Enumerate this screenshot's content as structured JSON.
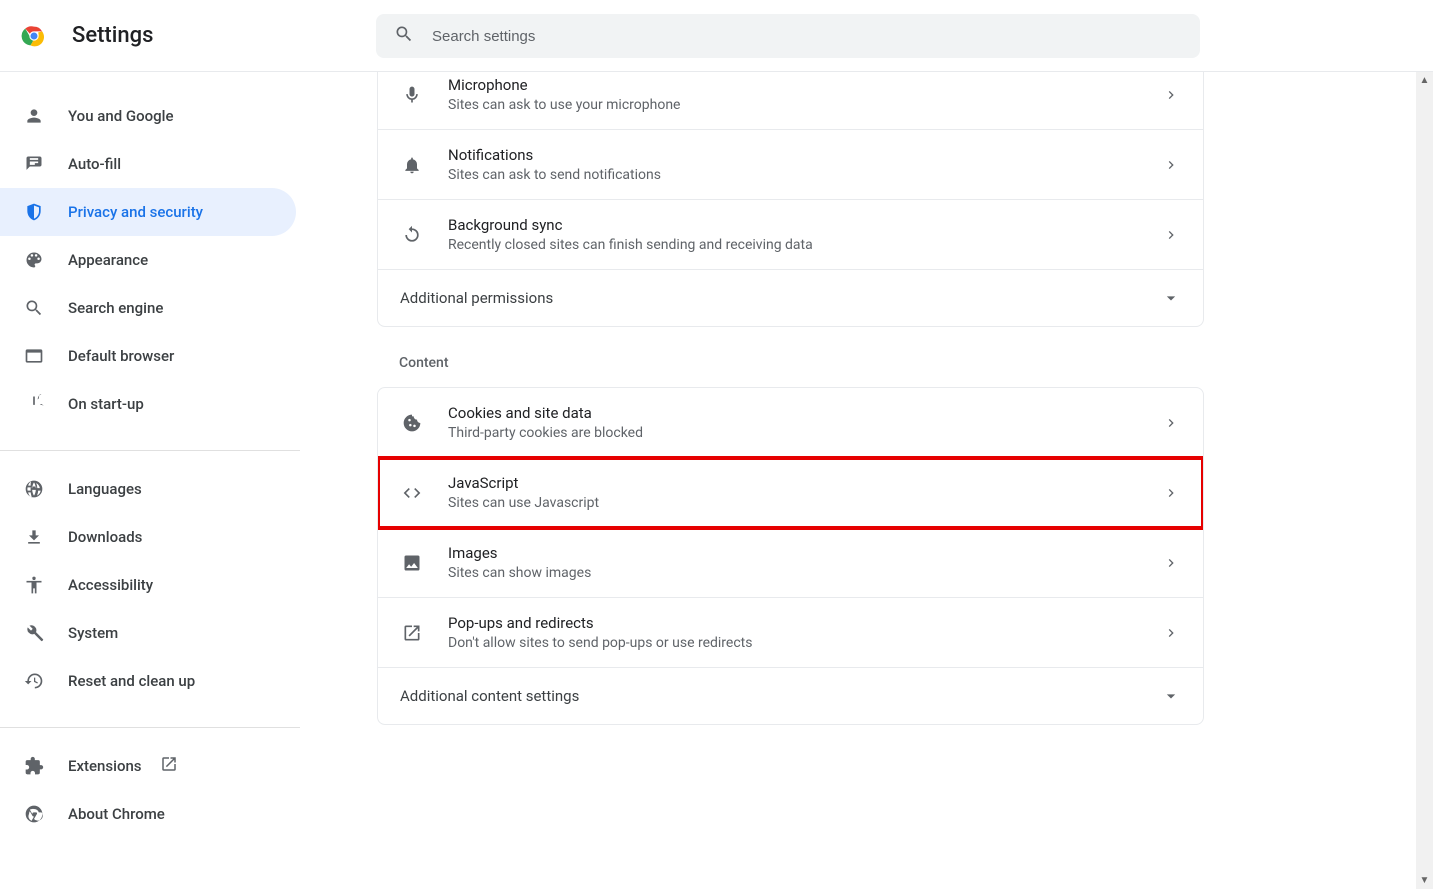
{
  "header": {
    "title": "Settings",
    "search_placeholder": "Search settings"
  },
  "sidebar": {
    "group1": [
      {
        "label": "You and Google",
        "icon": "person"
      },
      {
        "label": "Auto-fill",
        "icon": "autofill"
      },
      {
        "label": "Privacy and security",
        "icon": "shield",
        "active": true
      },
      {
        "label": "Appearance",
        "icon": "palette"
      },
      {
        "label": "Search engine",
        "icon": "search"
      },
      {
        "label": "Default browser",
        "icon": "browser"
      },
      {
        "label": "On start-up",
        "icon": "power"
      }
    ],
    "group2": [
      {
        "label": "Languages",
        "icon": "globe"
      },
      {
        "label": "Downloads",
        "icon": "download"
      },
      {
        "label": "Accessibility",
        "icon": "accessibility"
      },
      {
        "label": "System",
        "icon": "wrench"
      },
      {
        "label": "Reset and clean up",
        "icon": "restore"
      }
    ],
    "group3": [
      {
        "label": "Extensions",
        "icon": "extension",
        "external": true
      },
      {
        "label": "About Chrome",
        "icon": "chrome"
      }
    ]
  },
  "permissions": {
    "rows": [
      {
        "title": "Microphone",
        "sub": "Sites can ask to use your microphone",
        "icon": "mic"
      },
      {
        "title": "Notifications",
        "sub": "Sites can ask to send notifications",
        "icon": "bell"
      },
      {
        "title": "Background sync",
        "sub": "Recently closed sites can finish sending and receiving data",
        "icon": "sync"
      }
    ],
    "additional_label": "Additional permissions"
  },
  "content": {
    "heading": "Content",
    "rows": [
      {
        "title": "Cookies and site data",
        "sub": "Third-party cookies are blocked",
        "icon": "cookie"
      },
      {
        "title": "JavaScript",
        "sub": "Sites can use Javascript",
        "icon": "code",
        "highlight": true
      },
      {
        "title": "Images",
        "sub": "Sites can show images",
        "icon": "image"
      },
      {
        "title": "Pop-ups and redirects",
        "sub": "Don't allow sites to send pop-ups or use redirects",
        "icon": "launch"
      }
    ],
    "additional_label": "Additional content settings"
  }
}
